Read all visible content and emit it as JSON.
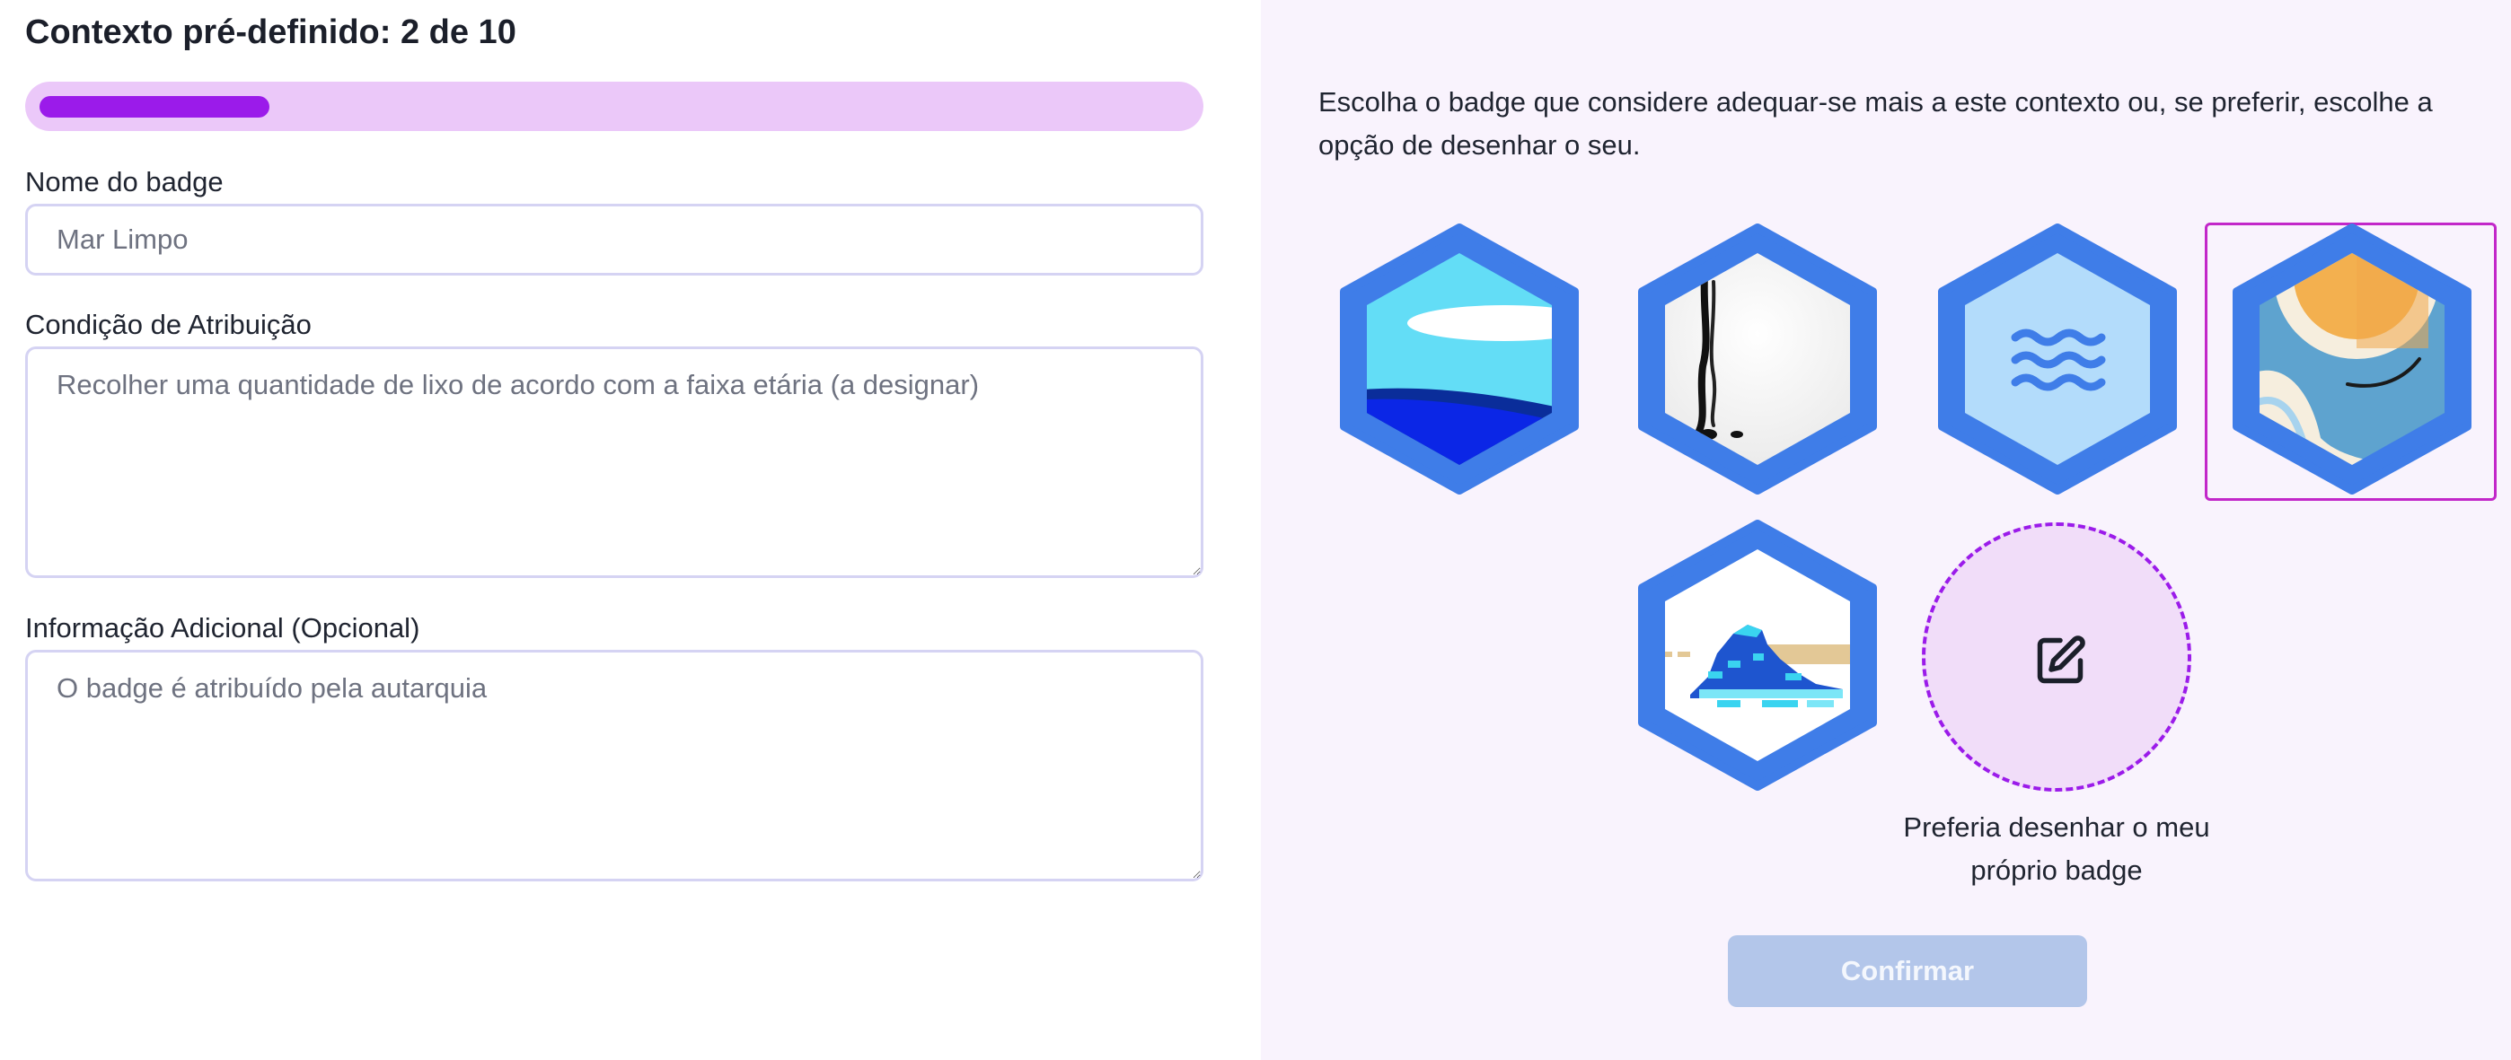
{
  "header": {
    "title": "Contexto pré-definido: 2 de 10",
    "progress": {
      "current": 2,
      "total": 10,
      "fraction": 0.2
    }
  },
  "form": {
    "badge_name": {
      "label": "Nome do badge",
      "value": "Mar Limpo"
    },
    "condition": {
      "label": "Condição de Atribuição",
      "value": "Recolher uma quantidade de lixo de acordo com a faixa etária (a designar)"
    },
    "additional_info": {
      "label": "Informação Adicional (Opcional)",
      "value": "O badge é atribuído pela autarquia"
    }
  },
  "badge_picker": {
    "instruction": "Escolha o badge que considere adequar-se mais a este contexto ou, se preferir, escolhe a opção de desenhar o seu.",
    "badges": [
      {
        "icon": "sea-landscape-icon",
        "selected": false
      },
      {
        "icon": "ink-drip-icon",
        "selected": false
      },
      {
        "icon": "waves-icon",
        "selected": false
      },
      {
        "icon": "sun-wave-icon",
        "selected": true
      },
      {
        "icon": "pixel-wave-icon",
        "selected": false
      }
    ],
    "draw_option": {
      "label": "Preferia desenhar o meu próprio badge",
      "icon": "edit-pencil-icon"
    }
  },
  "actions": {
    "confirm_label": "Confirmar",
    "confirm_disabled": true
  },
  "colors": {
    "accent": "#9b1bea",
    "progress_track": "#ebc8f9",
    "hexagon_blue": "#3f7de8",
    "panel_bg": "#f9f3fd",
    "confirm_disabled_bg": "#b3c6ea"
  }
}
